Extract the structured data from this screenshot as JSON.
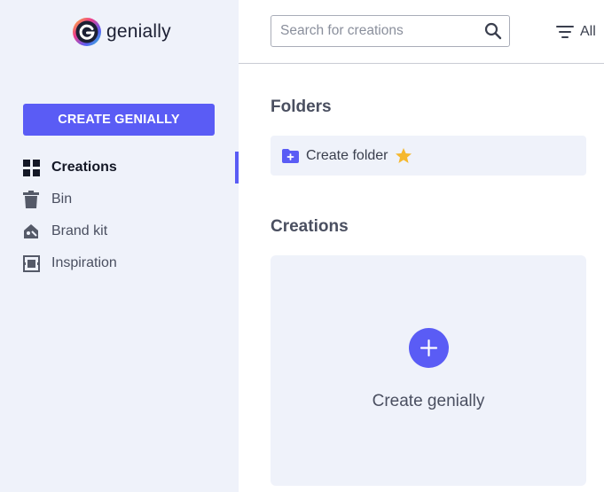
{
  "brand": {
    "name": "genially",
    "logo_icon": "genially-logo-icon"
  },
  "sidebar": {
    "create_button_label": "CREATE GENIALLY",
    "accent_color": "#5a5cf5",
    "items": [
      {
        "label": "Creations",
        "icon": "grid-icon",
        "active": true
      },
      {
        "label": "Bin",
        "icon": "trash-icon",
        "active": false
      },
      {
        "label": "Brand kit",
        "icon": "brand-kit-icon",
        "active": false
      },
      {
        "label": "Inspiration",
        "icon": "inspiration-icon",
        "active": false
      }
    ]
  },
  "topbar": {
    "search": {
      "placeholder": "Search for creations",
      "value": ""
    },
    "filter": {
      "label": "All",
      "icon": "filter-icon"
    }
  },
  "main": {
    "folders": {
      "title": "Folders",
      "create_folder_label": "Create folder",
      "create_folder_icon": "add-folder-icon",
      "badge_icon": "star-icon",
      "badge_color": "#f5b82e"
    },
    "creations": {
      "title": "Creations",
      "create_label": "Create genially",
      "create_icon": "plus-icon"
    }
  }
}
